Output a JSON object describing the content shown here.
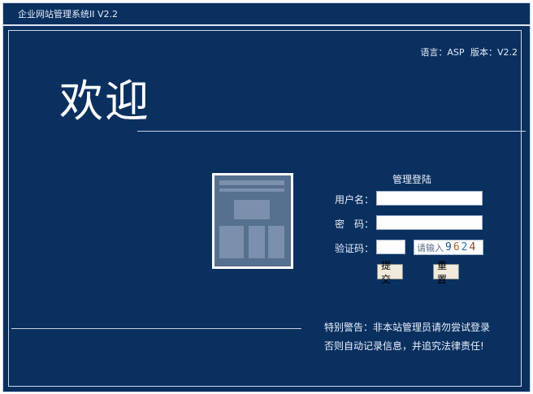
{
  "window": {
    "title": "企业网站管理系统II V2.2"
  },
  "header": {
    "language_label": "语言：ASP",
    "version_label": "版本：V2.2",
    "welcome": "欢迎"
  },
  "login": {
    "title": "管理登陆",
    "username_label": "用户名：",
    "password_label": "密　码：",
    "captcha_label": "验证码：",
    "captcha_hint": "请输入",
    "captcha_code": [
      "9",
      "6",
      "2",
      "4"
    ],
    "submit": "提交",
    "reset": "重置"
  },
  "warning": {
    "line1": "特别警告：非本站管理员请勿尝试登录",
    "line2": "否则自动记录信息，并追究法律责任!"
  },
  "colors": {
    "background": "#0a3060",
    "captcha_digits": [
      "#1b4f9a",
      "#b0611f",
      "#2a6fb8",
      "#8a4a2a"
    ]
  }
}
